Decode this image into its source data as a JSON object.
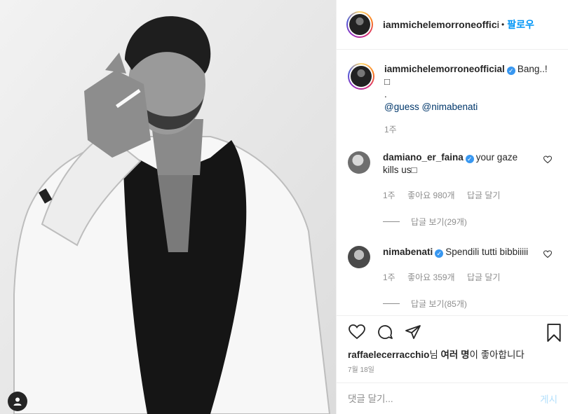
{
  "post": {
    "username": "iammichelemorroneofficial",
    "username_header": "iammichelemorroneoffici",
    "follow_label": "팔로우",
    "caption_text": "Bang..!",
    "caption_emoji": "□",
    "caption_dot": ".",
    "tags": [
      "@guess",
      "@nimabenati"
    ],
    "caption_time": "1주"
  },
  "comments": [
    {
      "username": "damiano_er_faina",
      "text": "your gaze kills us□",
      "time": "1주",
      "likes": "좋아요 980개",
      "reply": "답글 달기",
      "view_replies": "답글 보기(29개)"
    },
    {
      "username": "nimabenati",
      "text": "Spendili tutti bibbiiiii",
      "time": "1주",
      "likes": "좋아요 359개",
      "reply": "답글 달기",
      "view_replies": "답글 보기(85개)"
    }
  ],
  "likes": {
    "user": "raffaelecerracchio",
    "connector": "님",
    "others": "여러 명",
    "suffix": "이 좋아합니다"
  },
  "date": "7월 18일",
  "add_comment": {
    "placeholder": "댓글 달기...",
    "post_label": "게시"
  },
  "icons": {
    "like": "heart-icon",
    "comment": "comment-icon",
    "share": "share-icon",
    "save": "bookmark-icon",
    "user_tag": "user-icon"
  },
  "colors": {
    "link_blue": "#0095f6",
    "verified_blue": "#3897f0",
    "muted": "#8e8e8e"
  }
}
